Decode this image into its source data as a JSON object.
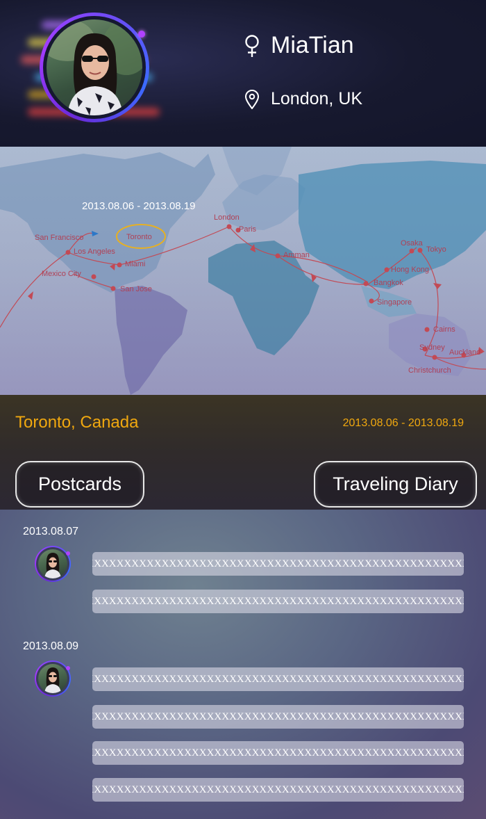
{
  "profile": {
    "name": "MiaTian",
    "location": "London, UK",
    "gender_icon": "female-symbol-icon",
    "location_icon": "map-pin-icon"
  },
  "map": {
    "trip_dates": "2013.08.06 - 2013.08.19",
    "highlighted_city": "Toronto",
    "cities": [
      "San Francisco",
      "Toronto",
      "Los Angeles",
      "Miami",
      "Mexico City",
      "San Jose",
      "London",
      "Paris",
      "Amman",
      "Osaka",
      "Tokyo",
      "Hong Kong",
      "Bangkok",
      "Singapore",
      "Cairns",
      "Sydney",
      "Auckland",
      "Christchurch"
    ]
  },
  "trip": {
    "city": "Toronto, Canada",
    "range": "2013.08.06 - 2013.08.19",
    "accent_color": "#f0a80f"
  },
  "tabs": {
    "postcards": "Postcards",
    "diary": "Traveling Diary"
  },
  "diary": {
    "groups": [
      {
        "date": "2013.08.07",
        "entries": [
          "XXXXXXXXXXXXXXXXXXXXXXXXXXXXXXXXXXXXXXXXXXXXXXXXXXXXXXX",
          "XXXXXXXXXXXXXXXXXXXXXXXXXXXXXXXXXXXXXXXXXXXXXXXXXXXXXXX"
        ]
      },
      {
        "date": "2013.08.09",
        "entries": [
          "XXXXXXXXXXXXXXXXXXXXXXXXXXXXXXXXXXXXXXXXXXXXXXXXXXXXXXX",
          "XXXXXXXXXXXXXXXXXXXXXXXXXXXXXXXXXXXXXXXXXXXXXXXXXXXXXXX",
          "XXXXXXXXXXXXXXXXXXXXXXXXXXXXXXXXXXXXXXXXXXXXXXXXXXXXXXX",
          "XXXXXXXXXXXXXXXXXXXXXXXXXXXXXXXXXXXXXXXXXXXXXXXXXXXXXXX"
        ]
      }
    ]
  }
}
